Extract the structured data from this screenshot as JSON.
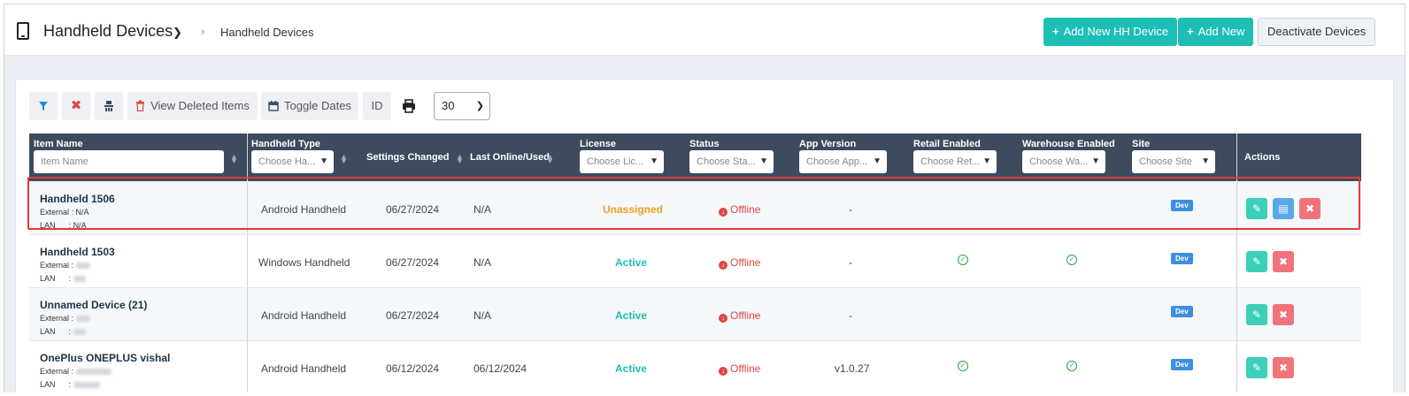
{
  "header": {
    "title": "Handheld Devices",
    "breadcrumb": "Handheld Devices",
    "add_hh_label": "Add New HH Device",
    "add_new_label": "Add New",
    "deactivate_label": "Deactivate Devices"
  },
  "toolbar": {
    "view_deleted_label": "View Deleted Items",
    "toggle_dates_label": "Toggle Dates",
    "id_label": "ID",
    "page_size": "30"
  },
  "columns": {
    "item_name": "Item Name",
    "item_name_placeholder": "Item Name",
    "handheld_type": "Handheld Type",
    "handheld_type_placeholder": "Choose Ha...",
    "settings_changed": "Settings Changed",
    "last_online": "Last Online/Used",
    "license": "License",
    "license_placeholder": "Choose Lic...",
    "status": "Status",
    "status_placeholder": "Choose Sta...",
    "app_version": "App Version",
    "app_version_placeholder": "Choose App...",
    "retail_enabled": "Retail Enabled",
    "retail_placeholder": "Choose Ret...",
    "warehouse_enabled": "Warehouse Enabled",
    "warehouse_placeholder": "Choose Wa...",
    "site": "Site",
    "site_placeholder": "Choose Site",
    "actions": "Actions"
  },
  "labels": {
    "external": "External :",
    "lan": "LAN",
    "lan_sep": ":"
  },
  "rows": [
    {
      "name": "Handheld 1506",
      "external": "N/A",
      "lan": "N/A",
      "type": "Android Handheld",
      "settings_changed": "06/27/2024",
      "last_online": "N/A",
      "license": "Unassigned",
      "status": "Offline",
      "app_version": "-",
      "retail_enabled": false,
      "warehouse_enabled": false,
      "site": "Dev"
    },
    {
      "name": "Handheld 1503",
      "type": "Windows Handheld",
      "settings_changed": "06/27/2024",
      "last_online": "N/A",
      "license": "Active",
      "status": "Offline",
      "app_version": "-",
      "retail_enabled": true,
      "warehouse_enabled": true,
      "site": "Dev"
    },
    {
      "name": "Unnamed Device (21)",
      "type": "Android Handheld",
      "settings_changed": "06/27/2024",
      "last_online": "N/A",
      "license": "Active",
      "status": "Offline",
      "app_version": "-",
      "retail_enabled": false,
      "warehouse_enabled": false,
      "site": "Dev"
    },
    {
      "name": "OnePlus ONEPLUS vishal",
      "type": "Android Handheld",
      "settings_changed": "06/12/2024",
      "last_online": "06/12/2024",
      "license": "Active",
      "status": "Offline",
      "app_version": "v1.0.27",
      "retail_enabled": true,
      "warehouse_enabled": true,
      "site": "Dev"
    }
  ],
  "icons": {
    "tablet": "tablet-icon",
    "filter": "filter-icon",
    "clear": "clear-filter-icon",
    "columns": "column-chooser-icon",
    "trash": "trash-icon",
    "calendar": "calendar-icon",
    "print": "print-icon",
    "offline": "offline-icon",
    "check": "check-circle-icon",
    "edit": "edit-icon",
    "card": "id-card-icon",
    "delete": "delete-icon"
  },
  "colors": {
    "accent": "#1dbfb4",
    "header_bg": "#3c4b5e",
    "unassigned": "#f0a020",
    "offline": "#e04444",
    "highlight": "#e53935",
    "site_badge": "#3d8fe0"
  }
}
